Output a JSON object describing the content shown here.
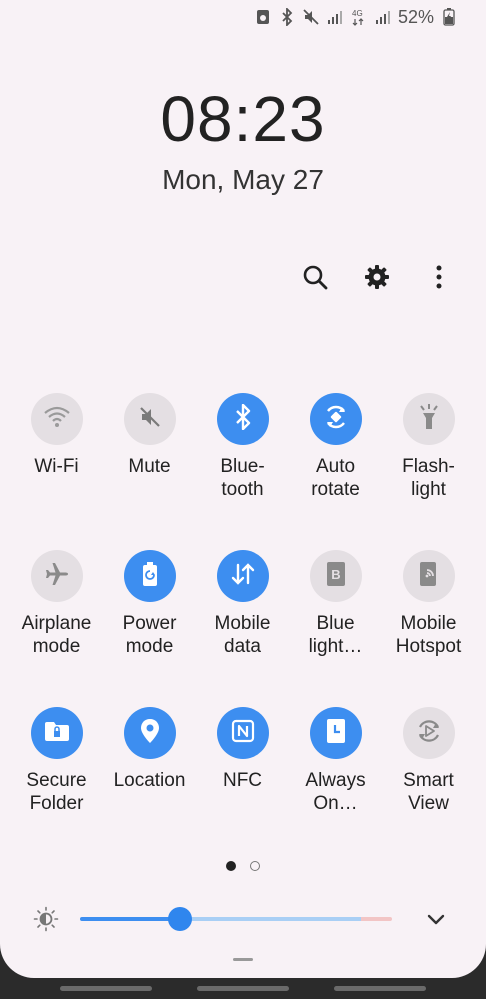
{
  "status_bar": {
    "battery_percent": "52%",
    "icons": [
      "data-saver-icon",
      "bluetooth-icon",
      "mute-icon",
      "signal-icon",
      "4g-signal-icon",
      "signal-icon",
      "battery-charging-icon"
    ]
  },
  "lock": {
    "time": "08:23",
    "date": "Mon, May 27"
  },
  "actions": [
    "search-icon",
    "settings-gear-icon",
    "more-vertical-icon"
  ],
  "tiles": [
    {
      "label": "Wi-Fi",
      "state": "off",
      "icon": "wifi-icon"
    },
    {
      "label": "Mute",
      "state": "off",
      "icon": "mute-icon"
    },
    {
      "label": "Blue-\ntooth",
      "state": "on",
      "icon": "bluetooth-icon"
    },
    {
      "label": "Auto\nrotate",
      "state": "on",
      "icon": "auto-rotate-icon"
    },
    {
      "label": "Flash-\nlight",
      "state": "off",
      "icon": "flashlight-icon"
    },
    {
      "label": "Airplane\nmode",
      "state": "off",
      "icon": "airplane-icon"
    },
    {
      "label": "Power\nmode",
      "state": "on",
      "icon": "power-mode-icon"
    },
    {
      "label": "Mobile\ndata",
      "state": "on",
      "icon": "mobile-data-icon"
    },
    {
      "label": "Blue\nlight…",
      "state": "off",
      "icon": "blue-light-icon"
    },
    {
      "label": "Mobile\nHotspot",
      "state": "off",
      "icon": "hotspot-icon"
    },
    {
      "label": "Secure\nFolder",
      "state": "on",
      "icon": "secure-folder-icon"
    },
    {
      "label": "Location",
      "state": "on",
      "icon": "location-icon"
    },
    {
      "label": "NFC",
      "state": "on",
      "icon": "nfc-icon"
    },
    {
      "label": "Always\nOn…",
      "state": "on",
      "icon": "always-on-display-icon"
    },
    {
      "label": "Smart\nView",
      "state": "off",
      "icon": "smart-view-icon"
    }
  ],
  "pager": {
    "pages": 2,
    "active": 0
  },
  "brightness": {
    "level": 0.32
  },
  "colors": {
    "accent": "#3d8ef0",
    "tile_off": "#e4dfe3",
    "panel_bg": "#f8f2f6"
  }
}
